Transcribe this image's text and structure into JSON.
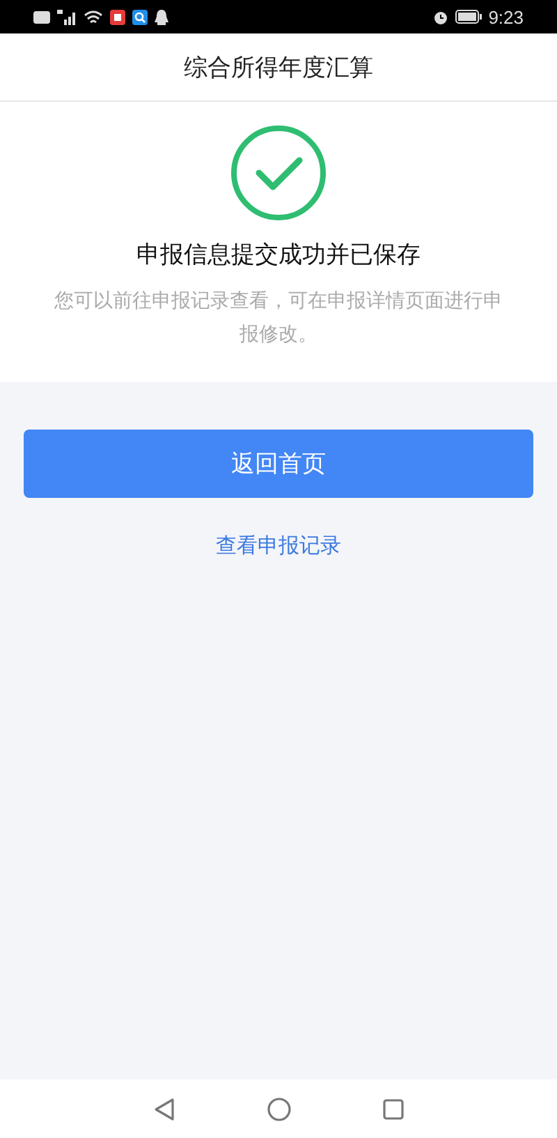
{
  "status_bar": {
    "time": "9:23"
  },
  "header": {
    "title": "综合所得年度汇算"
  },
  "result": {
    "title": "申报信息提交成功并已保存",
    "message": "您可以前往申报记录查看，可在申报详情页面进行申报修改。"
  },
  "primary_button": {
    "label": "返回首页"
  },
  "link": {
    "label": "查看申报记录"
  }
}
